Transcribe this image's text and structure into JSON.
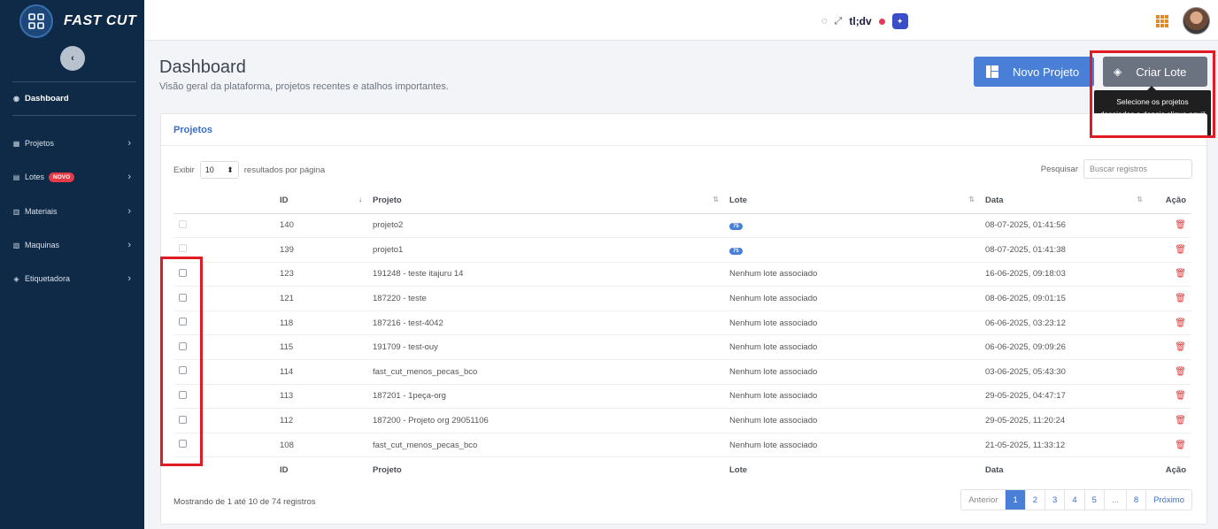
{
  "brand": {
    "name": "FAST CUT"
  },
  "sidebar": {
    "collapse_label": "‹",
    "items": [
      {
        "label": "Dashboard",
        "icon": "dashboard-icon",
        "glyph": "◉"
      },
      {
        "label": "Projetos",
        "icon": "projects-icon",
        "glyph": "▦"
      },
      {
        "label": "Lotes",
        "icon": "lotes-icon",
        "glyph": "▤",
        "badge": "NOVO"
      },
      {
        "label": "Materiais",
        "icon": "materials-icon",
        "glyph": "▥"
      },
      {
        "label": "Maquinas",
        "icon": "machine-icon",
        "glyph": "▧"
      },
      {
        "label": "Etiquetadora",
        "icon": "tag-icon",
        "glyph": "◈"
      }
    ]
  },
  "topbar": {
    "tldv": "tl;dv"
  },
  "header": {
    "title": "Dashboard",
    "subtitle": "Visão geral da plataforma, projetos recentes e atalhos importantes.",
    "btn_novo": "Novo Projeto",
    "btn_criar": "Criar Lote",
    "tooltip": "Selecione os projetos desejados e depois clique aqui!"
  },
  "card": {
    "title": "Projetos",
    "show_label": "Exibir",
    "page_size": "10",
    "per_page_label": "resultados por página",
    "search_label": "Pesquisar",
    "search_placeholder": "Buscar registros",
    "columns": [
      "ID",
      "Projeto",
      "Lote",
      "Data",
      "Ação"
    ],
    "rows": [
      {
        "id": "140",
        "projeto": "projeto2",
        "lote": "75",
        "lote_type": "badge",
        "data": "08-07-2025, 01:41:56"
      },
      {
        "id": "139",
        "projeto": "projeto1",
        "lote": "75",
        "lote_type": "badge",
        "data": "08-07-2025, 01:41:38"
      },
      {
        "id": "123",
        "projeto": "191248 - teste itajuru 14",
        "lote": "Nenhum lote associado",
        "lote_type": "text",
        "data": "16-06-2025, 09:18:03"
      },
      {
        "id": "121",
        "projeto": "187220 - teste",
        "lote": "Nenhum lote associado",
        "lote_type": "text",
        "data": "08-06-2025, 09:01:15"
      },
      {
        "id": "118",
        "projeto": "187216 - test-4042",
        "lote": "Nenhum lote associado",
        "lote_type": "text",
        "data": "06-06-2025, 03:23:12"
      },
      {
        "id": "115",
        "projeto": "191709 - test-ouy",
        "lote": "Nenhum lote associado",
        "lote_type": "text",
        "data": "06-06-2025, 09:09:26"
      },
      {
        "id": "114",
        "projeto": "fast_cut_menos_pecas_bco",
        "lote": "Nenhum lote associado",
        "lote_type": "text",
        "data": "03-06-2025, 05:43:30"
      },
      {
        "id": "113",
        "projeto": "187201 - 1peça-org",
        "lote": "Nenhum lote associado",
        "lote_type": "text",
        "data": "29-05-2025, 04:47:17"
      },
      {
        "id": "112",
        "projeto": "187200 - Projeto org 29051106",
        "lote": "Nenhum lote associado",
        "lote_type": "text",
        "data": "29-05-2025, 11:20:24"
      },
      {
        "id": "108",
        "projeto": "fast_cut_menos_pecas_bco",
        "lote": "Nenhum lote associado",
        "lote_type": "text",
        "data": "21-05-2025, 11:33:12"
      }
    ],
    "info": "Mostrando de 1 até 10 de 74 registros",
    "pagination": [
      "Anterior",
      "1",
      "2",
      "3",
      "4",
      "5",
      "...",
      "8",
      "Próximo"
    ]
  },
  "colors": {
    "sidebar": "#0e2a47",
    "primary": "#4a7fd8",
    "danger": "#e03b3b",
    "highlight": "#e01b24"
  }
}
